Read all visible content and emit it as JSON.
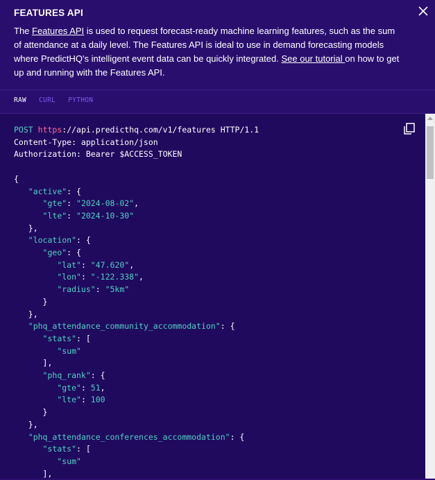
{
  "modal": {
    "title": "FEATURES API",
    "description": {
      "part1": "The ",
      "link1": "Features API",
      "part2": " is used to request forecast-ready machine learning features, such as the sum of attendance at a daily level. The Features API is ideal to use in demand forecasting models where PredictHQ's intelligent event data can be quickly integrated. ",
      "link2": "See our tutorial ",
      "part3": "on how to get up and running with the Features API."
    }
  },
  "tabs": [
    {
      "label": "RAW",
      "active": true
    },
    {
      "label": "CURL",
      "active": false
    },
    {
      "label": "PYTHON",
      "active": false
    }
  ],
  "request": {
    "method": "POST",
    "scheme": "https",
    "url_rest": "://api.predicthq.com/v1/features HTTP/1.1",
    "headers": [
      "Content-Type: application/json",
      "Authorization: Bearer $ACCESS_TOKEN"
    ]
  },
  "body_lines": [
    [
      [
        "pun",
        "{"
      ]
    ],
    [
      [
        "ind",
        "   "
      ],
      [
        "key",
        "\"active\""
      ],
      [
        "pun",
        ": {"
      ]
    ],
    [
      [
        "ind",
        "      "
      ],
      [
        "key",
        "\"gte\""
      ],
      [
        "pun",
        ": "
      ],
      [
        "str",
        "\"2024-08-02\""
      ],
      [
        "pun",
        ","
      ]
    ],
    [
      [
        "ind",
        "      "
      ],
      [
        "key",
        "\"lte\""
      ],
      [
        "pun",
        ": "
      ],
      [
        "str",
        "\"2024-10-30\""
      ]
    ],
    [
      [
        "ind",
        "   "
      ],
      [
        "pun",
        "},"
      ]
    ],
    [
      [
        "ind",
        "   "
      ],
      [
        "key",
        "\"location\""
      ],
      [
        "pun",
        ": {"
      ]
    ],
    [
      [
        "ind",
        "      "
      ],
      [
        "key",
        "\"geo\""
      ],
      [
        "pun",
        ": {"
      ]
    ],
    [
      [
        "ind",
        "         "
      ],
      [
        "key",
        "\"lat\""
      ],
      [
        "pun",
        ": "
      ],
      [
        "str",
        "\"47.620\""
      ],
      [
        "pun",
        ","
      ]
    ],
    [
      [
        "ind",
        "         "
      ],
      [
        "key",
        "\"lon\""
      ],
      [
        "pun",
        ": "
      ],
      [
        "str",
        "\"-122.338\""
      ],
      [
        "pun",
        ","
      ]
    ],
    [
      [
        "ind",
        "         "
      ],
      [
        "key",
        "\"radius\""
      ],
      [
        "pun",
        ": "
      ],
      [
        "str",
        "\"5km\""
      ]
    ],
    [
      [
        "ind",
        "      "
      ],
      [
        "pun",
        "}"
      ]
    ],
    [
      [
        "ind",
        "   "
      ],
      [
        "pun",
        "},"
      ]
    ],
    [
      [
        "ind",
        "   "
      ],
      [
        "key",
        "\"phq_attendance_community_accommodation\""
      ],
      [
        "pun",
        ": {"
      ]
    ],
    [
      [
        "ind",
        "      "
      ],
      [
        "key",
        "\"stats\""
      ],
      [
        "pun",
        ": ["
      ]
    ],
    [
      [
        "ind",
        "         "
      ],
      [
        "str",
        "\"sum\""
      ]
    ],
    [
      [
        "ind",
        "      "
      ],
      [
        "pun",
        "],"
      ]
    ],
    [
      [
        "ind",
        "      "
      ],
      [
        "key",
        "\"phq_rank\""
      ],
      [
        "pun",
        ": {"
      ]
    ],
    [
      [
        "ind",
        "         "
      ],
      [
        "key",
        "\"gte\""
      ],
      [
        "pun",
        ": "
      ],
      [
        "num",
        "51"
      ],
      [
        "pun",
        ","
      ]
    ],
    [
      [
        "ind",
        "         "
      ],
      [
        "key",
        "\"lte\""
      ],
      [
        "pun",
        ": "
      ],
      [
        "num",
        "100"
      ]
    ],
    [
      [
        "ind",
        "      "
      ],
      [
        "pun",
        "}"
      ]
    ],
    [
      [
        "ind",
        "   "
      ],
      [
        "pun",
        "},"
      ]
    ],
    [
      [
        "ind",
        "   "
      ],
      [
        "key",
        "\"phq_attendance_conferences_accommodation\""
      ],
      [
        "pun",
        ": {"
      ]
    ],
    [
      [
        "ind",
        "      "
      ],
      [
        "key",
        "\"stats\""
      ],
      [
        "pun",
        ": ["
      ]
    ],
    [
      [
        "ind",
        "         "
      ],
      [
        "str",
        "\"sum\""
      ]
    ],
    [
      [
        "ind",
        "      "
      ],
      [
        "pun",
        "],"
      ]
    ]
  ]
}
